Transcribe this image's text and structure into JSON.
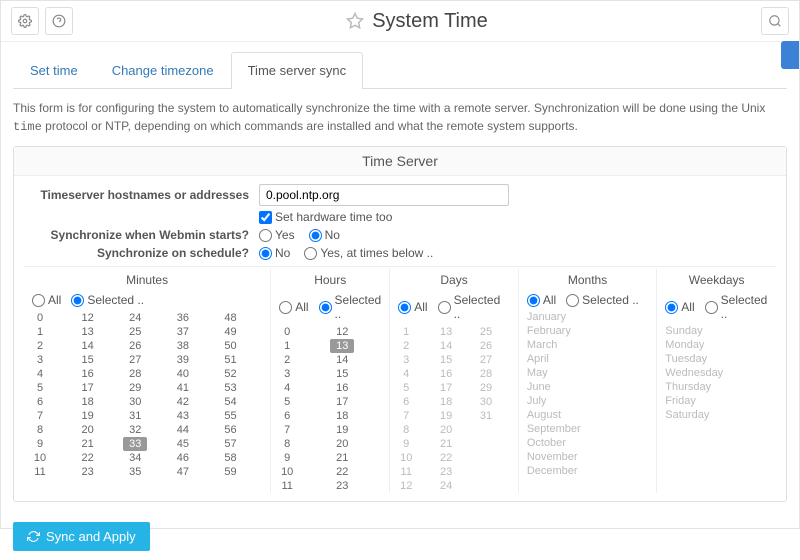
{
  "title": "System Time",
  "tabs": [
    "Set time",
    "Change timezone",
    "Time server sync"
  ],
  "activeTab": 2,
  "desc_a": "This form is for configuring the system to automatically synchronize the time with a remote server. Synchronization will be done using the Unix ",
  "desc_code": "time",
  "desc_b": " protocol or NTP, depending on which commands are installed and what the remote system supports.",
  "panelTitle": "Time Server",
  "lbl_host": "Timeserver hostnames or addresses",
  "val_host": "0.pool.ntp.org",
  "lbl_hw": "Set hardware time too",
  "lbl_boot": "Synchronize when Webmin starts?",
  "lbl_sched": "Synchronize on schedule?",
  "opt_yes": "Yes",
  "opt_no": "No",
  "opt_times": "Yes, at times below ..",
  "opt_all": "All",
  "opt_sel": "Selected ..",
  "cols": {
    "min": "Minutes",
    "hr": "Hours",
    "day": "Days",
    "mon": "Months",
    "wd": "Weekdays"
  },
  "sel_min": [
    33
  ],
  "sel_hr": [
    13
  ],
  "months": [
    "January",
    "February",
    "March",
    "April",
    "May",
    "June",
    "July",
    "August",
    "September",
    "October",
    "November",
    "December"
  ],
  "weekdays": [
    "Sunday",
    "Monday",
    "Tuesday",
    "Wednesday",
    "Thursday",
    "Friday",
    "Saturday"
  ],
  "btn": "Sync and Apply"
}
